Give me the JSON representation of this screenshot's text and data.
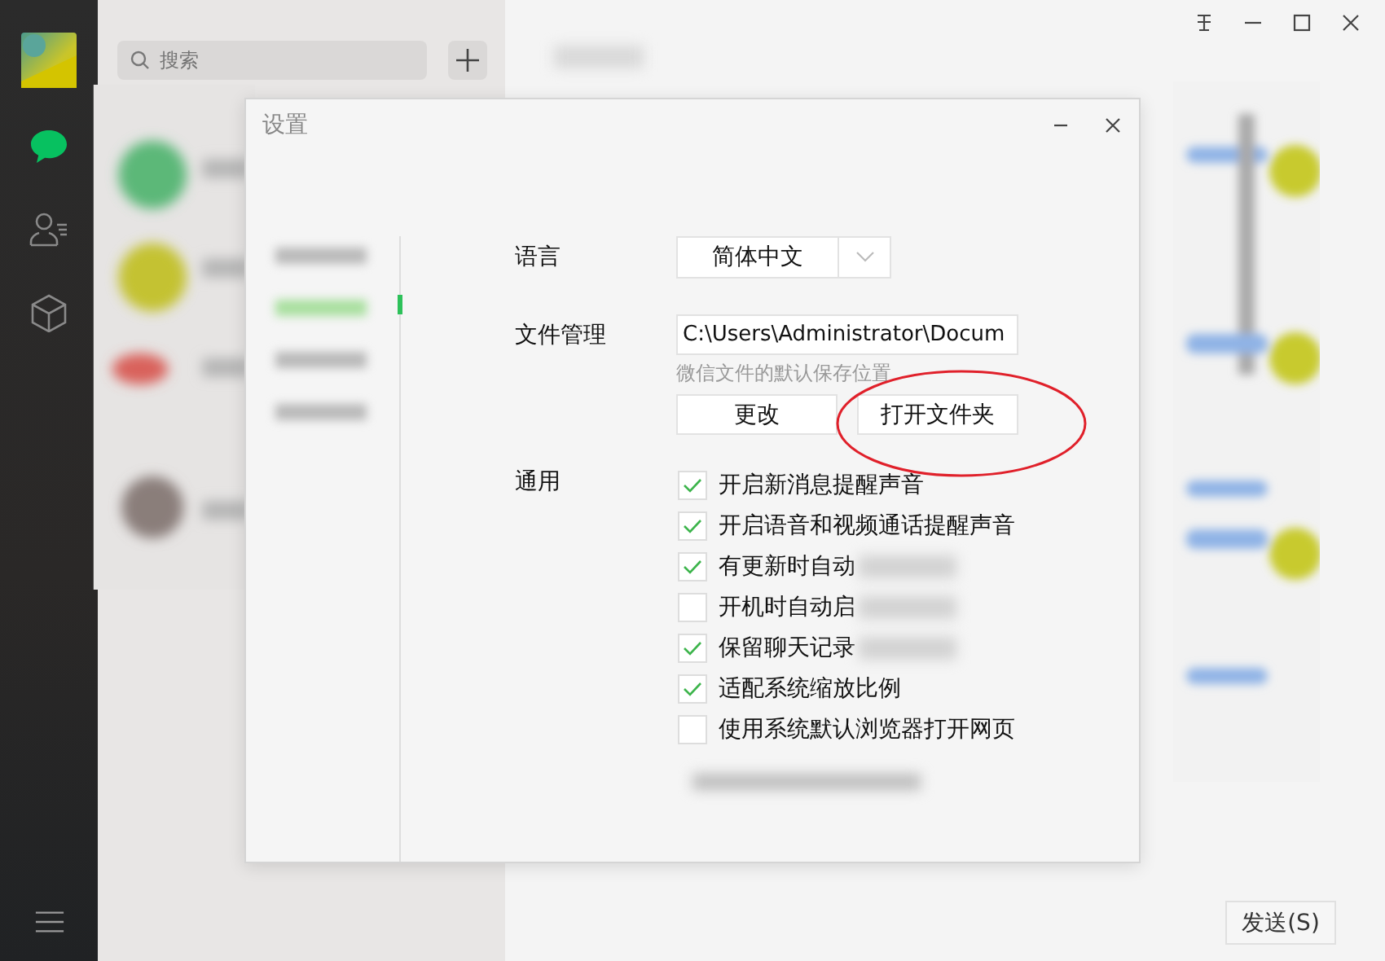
{
  "sidebar": {
    "nav": [
      {
        "kind": "chat",
        "selected": true
      },
      {
        "kind": "contacts",
        "selected": false
      },
      {
        "kind": "box",
        "selected": false
      }
    ]
  },
  "search": {
    "placeholder": "搜索"
  },
  "settings_dialog": {
    "title": "设置",
    "nav_items": [
      {
        "selected": false
      },
      {
        "selected": true
      },
      {
        "selected": false
      },
      {
        "selected": false
      }
    ],
    "language": {
      "label": "语言",
      "value": "简体中文"
    },
    "file_management": {
      "label": "文件管理",
      "path": "C:\\Users\\Administrator\\Docum",
      "hint": "微信文件的默认保存位置",
      "buttons": [
        "更改",
        "打开文件夹"
      ]
    },
    "general": {
      "label": "通用",
      "options": [
        {
          "text": "开启新消息提醒声音",
          "checked": true,
          "obscured": false
        },
        {
          "text": "开启语音和视频通话提醒声音",
          "checked": true,
          "obscured": false
        },
        {
          "text": "有更新时自动",
          "checked": true,
          "obscured": true
        },
        {
          "text": "开机时自动启",
          "checked": false,
          "obscured": true
        },
        {
          "text": "保留聊天记录",
          "checked": true,
          "obscured": true
        },
        {
          "text": "适配系统缩放比例",
          "checked": true,
          "obscured": false
        },
        {
          "text": "使用系统默认浏览器打开网页",
          "checked": false,
          "obscured": false
        }
      ]
    }
  },
  "send_button": "发送(S)"
}
